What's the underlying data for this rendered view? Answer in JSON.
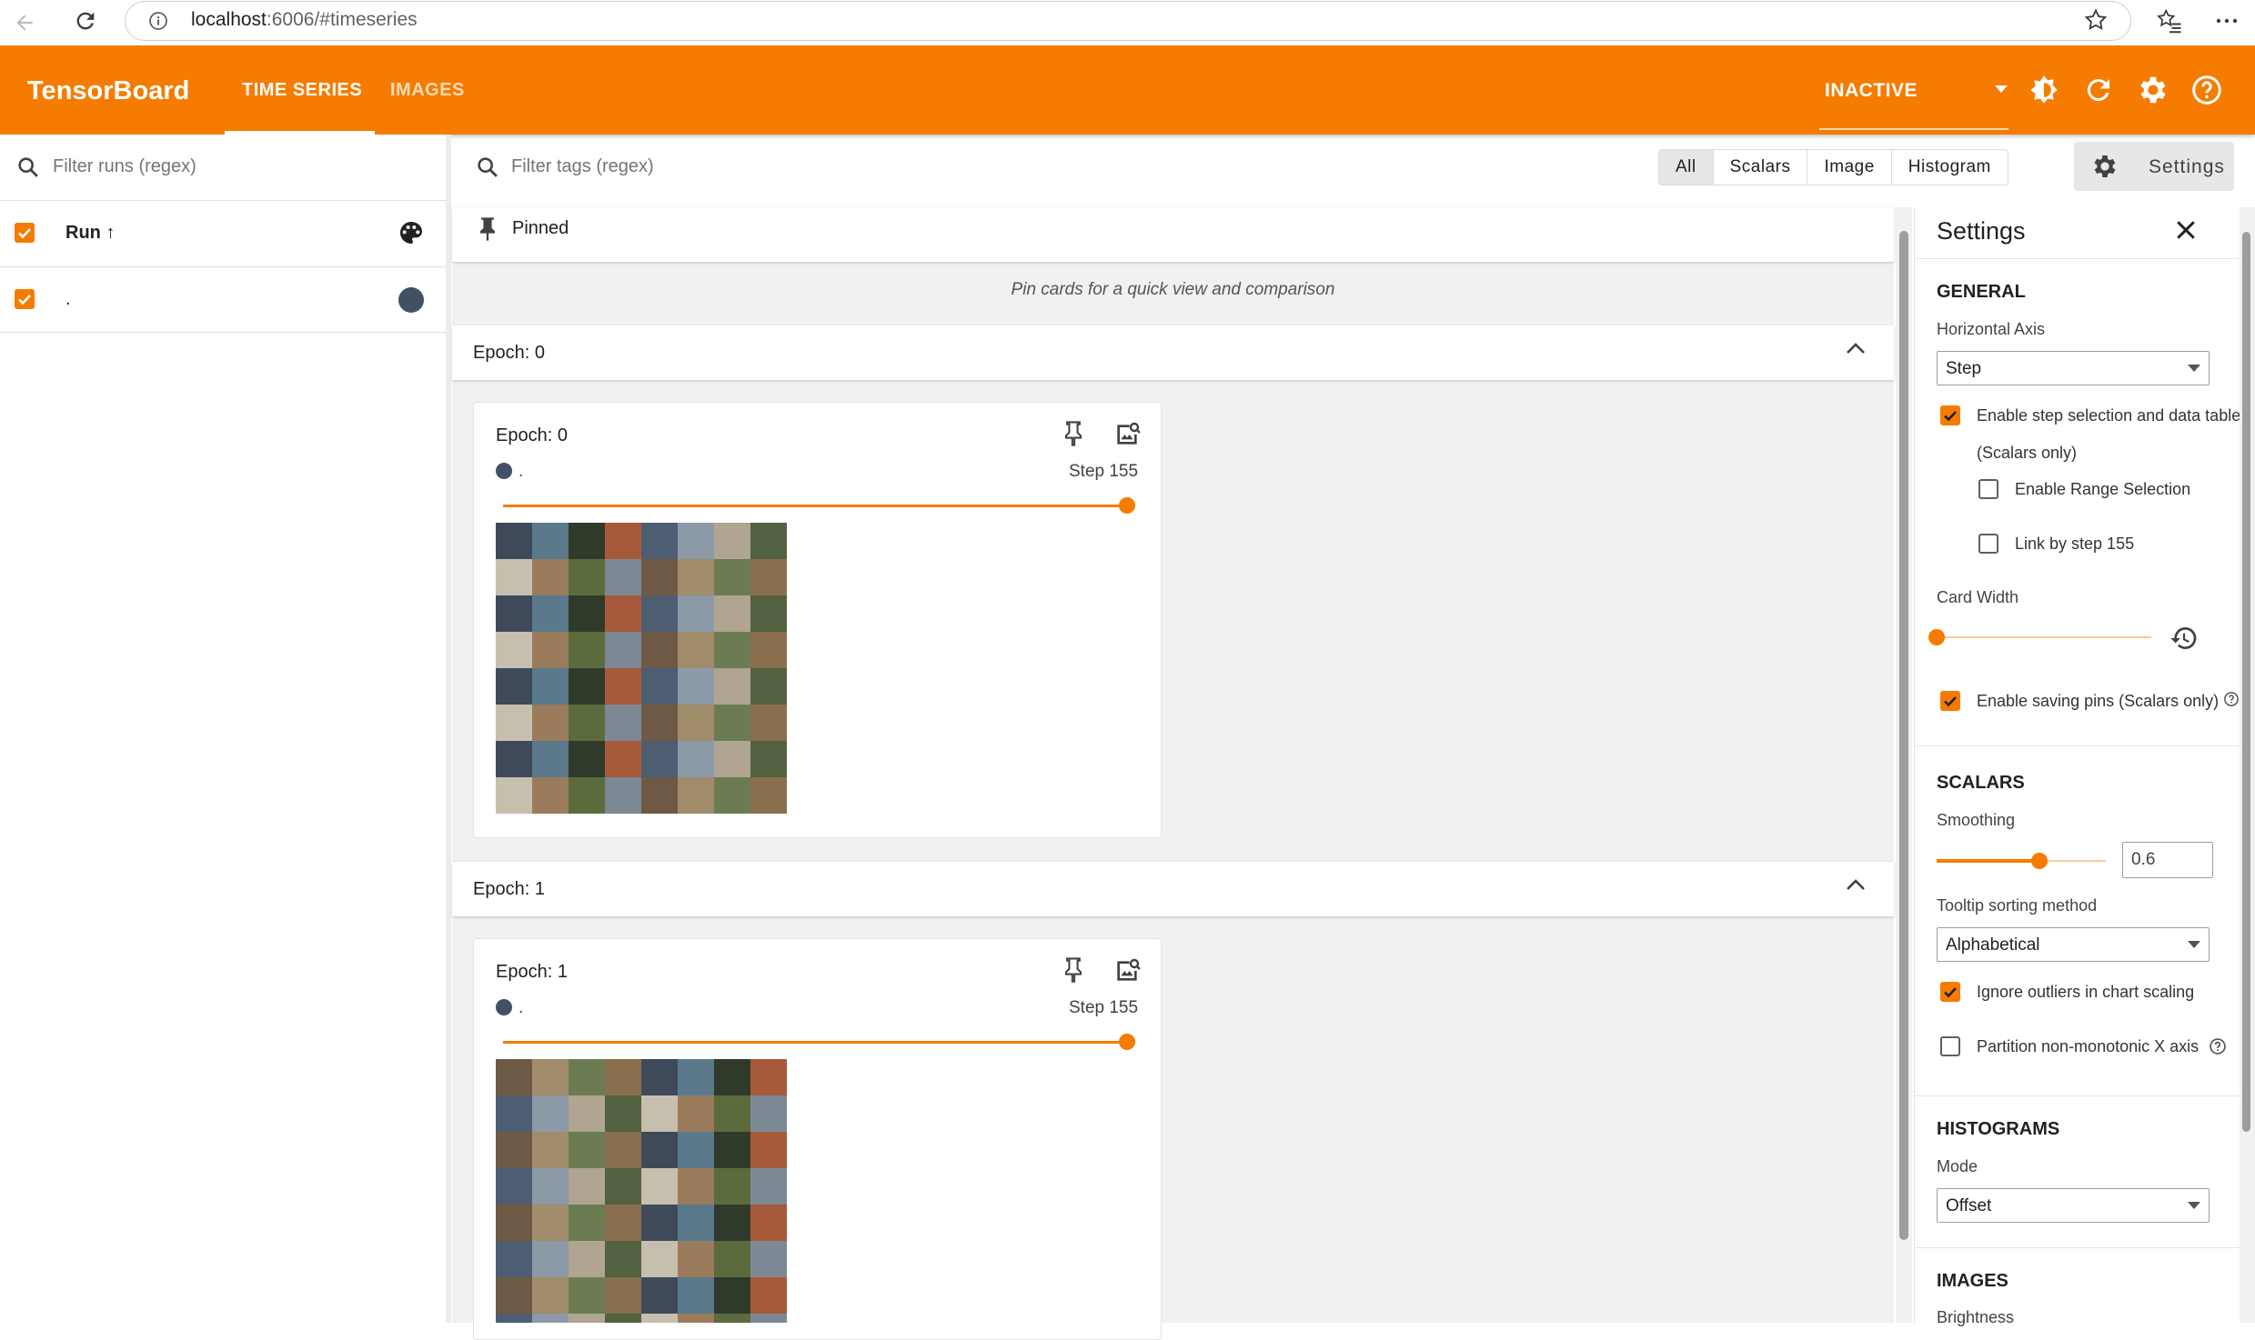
{
  "browser": {
    "url_host": "localhost",
    "url_rest": ":6006/#timeseries"
  },
  "header": {
    "brand": "TensorBoard",
    "tabs": [
      {
        "label": "TIME SERIES",
        "active": true
      },
      {
        "label": "IMAGES",
        "active": false
      }
    ],
    "status": "INACTIVE"
  },
  "runs": {
    "filter_placeholder": "Filter runs (regex)",
    "column_label": "Run",
    "sort_indicator": "↑",
    "items": [
      {
        "name": ".",
        "checked": true,
        "color": "#425066"
      }
    ]
  },
  "toolbar": {
    "tags_placeholder": "Filter tags (regex)",
    "type_filters": [
      "All",
      "Scalars",
      "Image",
      "Histogram"
    ],
    "settings_label": "Settings"
  },
  "pinned": {
    "title": "Pinned",
    "hint": "Pin cards for a quick view and comparison"
  },
  "sections": [
    {
      "title": "Epoch: 0",
      "card": {
        "title": "Epoch: 0",
        "run": ".",
        "step": "Step 155",
        "step_fraction": 1.0
      }
    },
    {
      "title": "Epoch: 1",
      "card": {
        "title": "Epoch: 1",
        "run": ".",
        "step": "Step 155",
        "step_fraction": 1.0
      }
    }
  ],
  "settings": {
    "title": "Settings",
    "general": {
      "heading": "GENERAL",
      "horizontal_axis_label": "Horizontal Axis",
      "horizontal_axis_value": "Step",
      "step_selection_label": "Enable step selection and data table",
      "step_selection_sub": "(Scalars only)",
      "step_selection_checked": true,
      "range_selection_label": "Enable Range Selection",
      "range_selection_checked": false,
      "link_step_label": "Link by step 155",
      "link_step_checked": false,
      "card_width_label": "Card Width",
      "card_width_fraction": 0.0,
      "saving_pins_label": "Enable saving pins (Scalars only)",
      "saving_pins_checked": true
    },
    "scalars": {
      "heading": "SCALARS",
      "smoothing_label": "Smoothing",
      "smoothing_value": "0.6",
      "tooltip_label": "Tooltip sorting method",
      "tooltip_value": "Alphabetical",
      "ignore_outliers_label": "Ignore outliers in chart scaling",
      "ignore_outliers_checked": true,
      "partition_label": "Partition non-monotonic X axis",
      "partition_checked": false
    },
    "histograms": {
      "heading": "HISTOGRAMS",
      "mode_label": "Mode",
      "mode_value": "Offset"
    },
    "images": {
      "heading": "IMAGES",
      "brightness_label": "Brightness"
    }
  },
  "colors": {
    "accent": "#f57c00",
    "run_color": "#425066"
  }
}
